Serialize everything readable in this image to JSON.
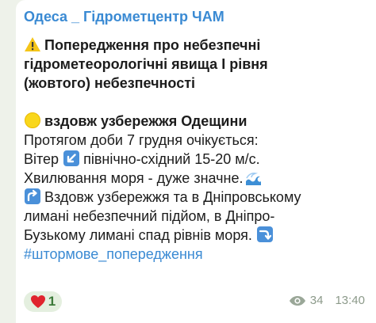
{
  "channel": {
    "name": "Одеса _ Гідрометцентр ЧАМ"
  },
  "message": {
    "title_lines": [
      "Попередження про небезпечні",
      "гідрометеорологічні явища І рівня",
      "(жовтого) небезпечності"
    ],
    "region": "вздовж узбережжя Одещини",
    "forecast_line": "Протягом доби 7 грудня очікується:",
    "wind_prefix": "Вітер",
    "wind_suffix": "північно-східний 15-20 м/с.",
    "sea_text": "Хвилювання моря - дуже значне.",
    "coast_lines": [
      "Вздовж узбережжя та в Дніпровському",
      "лимані небезпечний підйом, в Дніпро-",
      "Бузькому лимані спад рівнів моря."
    ],
    "hashtag": "#штормове_попередження",
    "icons": {
      "warning": "warning-icon",
      "region": "yellow-circle-icon",
      "wind": "down-left-arrow-icon",
      "sea": "water-wave-icon",
      "rise": "up-right-arrow-icon",
      "fall": "right-down-arrow-icon"
    }
  },
  "footer": {
    "reaction_emoji": "red-heart",
    "reaction_count": "1",
    "views": "34",
    "time": "13:40"
  },
  "colors": {
    "link": "#3a8ad3",
    "text": "#1c1c1c",
    "background": "#eef2ea",
    "reaction_bg": "#e4efdf",
    "meta": "#8c9a8a"
  }
}
